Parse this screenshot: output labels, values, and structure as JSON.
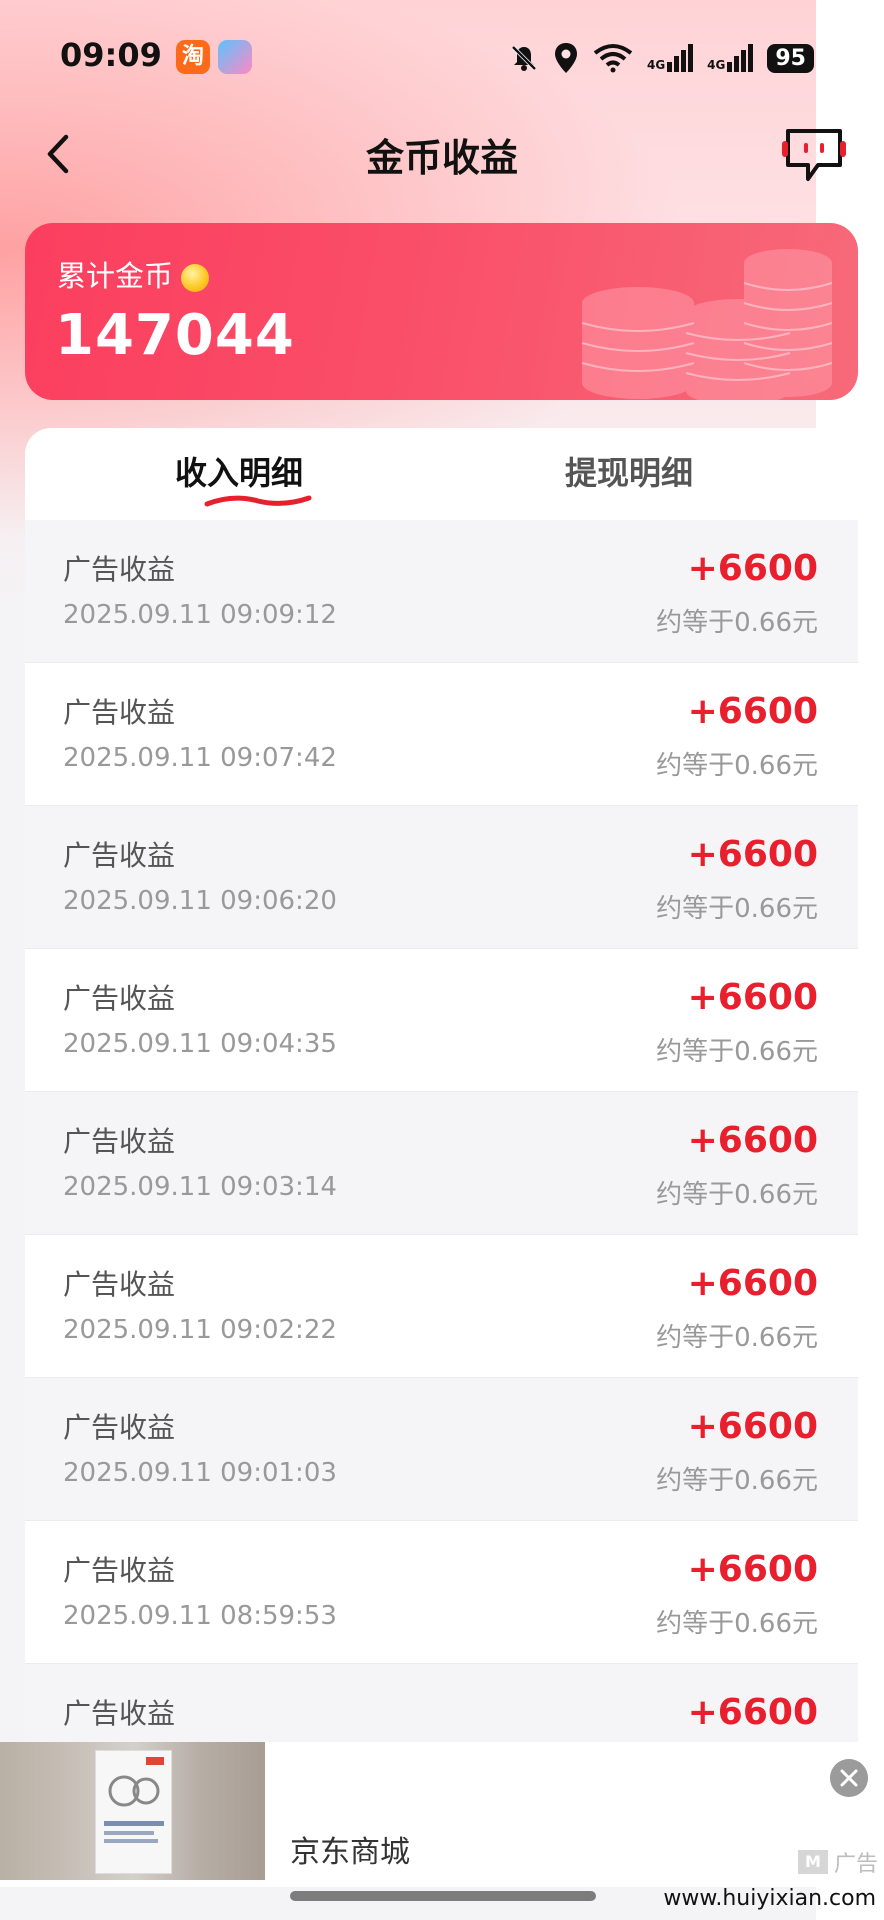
{
  "status_bar": {
    "time": "09:09",
    "app_icons": [
      {
        "label": "淘",
        "color": "#ff6a1a",
        "name": "taobao-app-icon"
      },
      {
        "label": "",
        "color": "#6fa8ff",
        "name": "game-app-icon"
      }
    ],
    "signal_1": "4G",
    "signal_2": "4G",
    "battery": "95"
  },
  "nav": {
    "title": "金币收益"
  },
  "coin_card": {
    "label": "累计金币",
    "value": "147044",
    "accent": "#fb3e5f"
  },
  "tabs": {
    "income": "收入明细",
    "withdraw": "提现明细"
  },
  "records": [
    {
      "title": "广告收益",
      "time": "2025.09.11 09:09:12",
      "amount": "+6600",
      "approx": "约等于0.66元"
    },
    {
      "title": "广告收益",
      "time": "2025.09.11 09:07:42",
      "amount": "+6600",
      "approx": "约等于0.66元"
    },
    {
      "title": "广告收益",
      "time": "2025.09.11 09:06:20",
      "amount": "+6600",
      "approx": "约等于0.66元"
    },
    {
      "title": "广告收益",
      "time": "2025.09.11 09:04:35",
      "amount": "+6600",
      "approx": "约等于0.66元"
    },
    {
      "title": "广告收益",
      "time": "2025.09.11 09:03:14",
      "amount": "+6600",
      "approx": "约等于0.66元"
    },
    {
      "title": "广告收益",
      "time": "2025.09.11 09:02:22",
      "amount": "+6600",
      "approx": "约等于0.66元"
    },
    {
      "title": "广告收益",
      "time": "2025.09.11 09:01:03",
      "amount": "+6600",
      "approx": "约等于0.66元"
    },
    {
      "title": "广告收益",
      "time": "2025.09.11 08:59:53",
      "amount": "+6600",
      "approx": "约等于0.66元"
    },
    {
      "title": "广告收益",
      "time": "",
      "amount": "+6600",
      "approx": ""
    }
  ],
  "ad": {
    "name": "京东商城",
    "mark": "广告"
  },
  "watermark": "www.huiyixian.com",
  "colors": {
    "amount": "#e8202e",
    "card_start": "#fb3e5f",
    "card_end": "#f76a7a"
  }
}
